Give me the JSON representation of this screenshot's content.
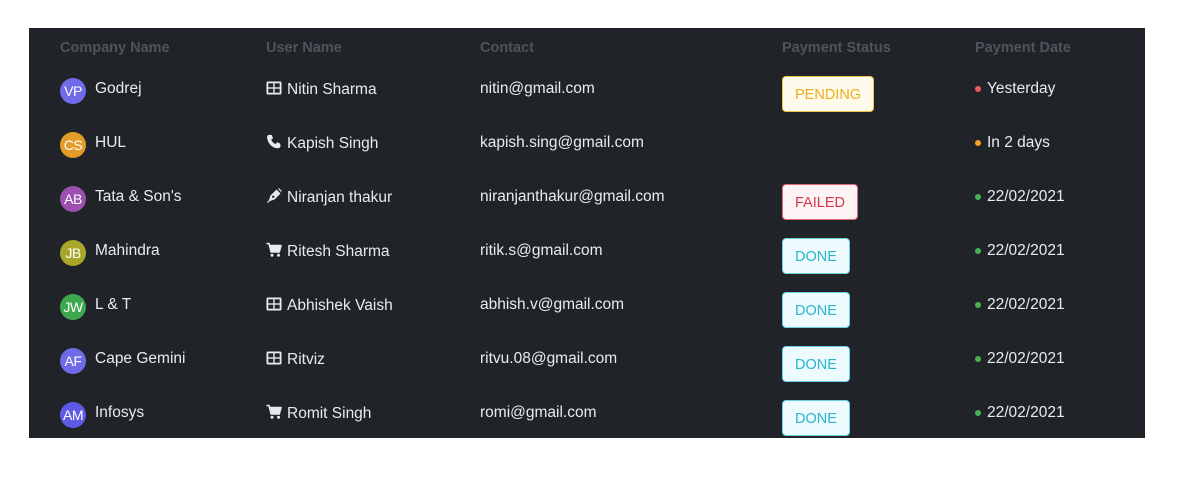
{
  "headers": {
    "company": "Company Name",
    "user": "User Name",
    "contact": "Contact",
    "status": "Payment Status",
    "date": "Payment Date"
  },
  "rows": [
    {
      "initials": "VP",
      "avatar_color": "#6f6be8",
      "company": "Godrej",
      "user_icon": "table-icon",
      "user": "Nitin Sharma",
      "contact": "nitin@gmail.com",
      "status": "PENDING",
      "status_type": "pending",
      "date": "Yesterday",
      "dot_color": "#ef5a5a"
    },
    {
      "initials": "CS",
      "avatar_color": "#e39c2a",
      "company": "HUL",
      "user_icon": "phone-icon",
      "user": "Kapish Singh",
      "contact": "kapish.sing@gmail.com",
      "status": "",
      "status_type": "none",
      "date": "In 2 days",
      "dot_color": "#f5a11b"
    },
    {
      "initials": "AB",
      "avatar_color": "#9c4fae",
      "company": "Tata & Son's",
      "user_icon": "pen-icon",
      "user": "Niranjan thakur",
      "contact": "niranjanthakur@gmail.com",
      "status": "FAILED",
      "status_type": "failed",
      "date": "22/02/2021",
      "dot_color": "#44b551"
    },
    {
      "initials": "JB",
      "avatar_color": "#a8a72b",
      "company": "Mahindra",
      "user_icon": "cart-icon",
      "user": "Ritesh Sharma",
      "contact": "ritik.s@gmail.com",
      "status": "DONE",
      "status_type": "done",
      "date": "22/02/2021",
      "dot_color": "#44b551"
    },
    {
      "initials": "JW",
      "avatar_color": "#3ea84f",
      "company": "L & T",
      "user_icon": "table-icon",
      "user": "Abhishek Vaish",
      "contact": "abhish.v@gmail.com",
      "status": "DONE",
      "status_type": "done",
      "date": "22/02/2021",
      "dot_color": "#44b551"
    },
    {
      "initials": "AF",
      "avatar_color": "#6f6be8",
      "company": "Cape Gemini",
      "user_icon": "table-icon",
      "user": "Ritviz",
      "contact": "ritvu.08@gmail.com",
      "status": "DONE",
      "status_type": "done",
      "date": "22/02/2021",
      "dot_color": "#44b551"
    },
    {
      "initials": "AM",
      "avatar_color": "#5f5ae6",
      "company": "Infosys",
      "user_icon": "cart-icon",
      "user": "Romit Singh",
      "contact": "romi@gmail.com",
      "status": "DONE",
      "status_type": "done",
      "date": "22/02/2021",
      "dot_color": "#44b551"
    }
  ]
}
